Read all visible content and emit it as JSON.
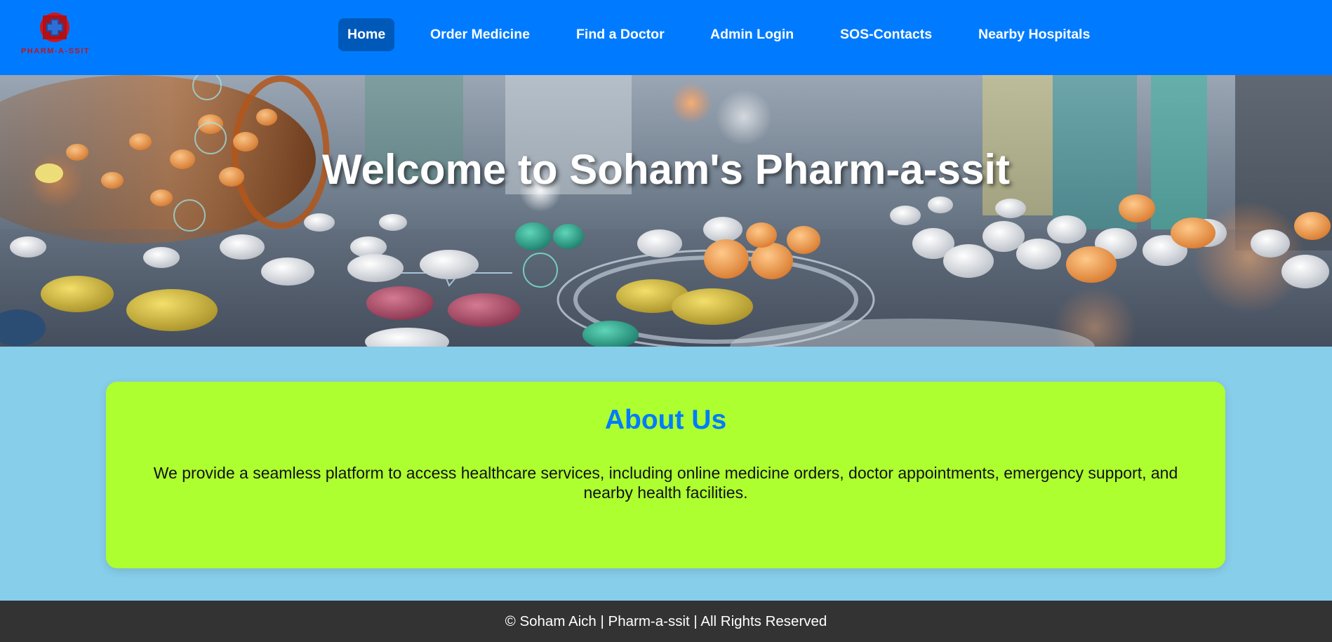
{
  "header": {
    "logo_text": "PHARM-A-SSIT",
    "nav": [
      {
        "label": "Home",
        "active": true
      },
      {
        "label": "Order Medicine",
        "active": false
      },
      {
        "label": "Find a Doctor",
        "active": false
      },
      {
        "label": "Admin Login",
        "active": false
      },
      {
        "label": "SOS-Contacts",
        "active": false
      },
      {
        "label": "Nearby Hospitals",
        "active": false
      }
    ]
  },
  "hero": {
    "title": "Welcome to Soham's Pharm-a-ssit"
  },
  "about": {
    "heading": "About Us",
    "text": "We provide a seamless platform to access healthcare services, including online medicine orders, doctor appointments, emergency support, and nearby health facilities."
  },
  "footer": {
    "text": "© Soham Aich | Pharm-a-ssit | All Rights Reserved"
  },
  "colors": {
    "header_bg": "#007bff",
    "active_nav_bg": "#0059b9",
    "page_bg": "#87ceeb",
    "about_bg": "#adff2f",
    "about_heading": "#007bff",
    "footer_bg": "#333333",
    "logo_red": "#d2161e"
  },
  "icons": [
    "medical-cross-logo-icon"
  ]
}
